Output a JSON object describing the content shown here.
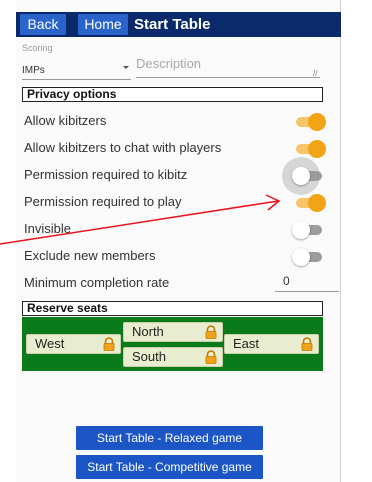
{
  "header": {
    "back_label": "Back",
    "home_label": "Home",
    "title": "Start Table"
  },
  "scoring": {
    "label": "Scoring",
    "value": "IMPs"
  },
  "description": {
    "placeholder": "Description"
  },
  "privacy": {
    "heading": "Privacy options",
    "options": [
      {
        "label": "Allow kibitzers",
        "on": true
      },
      {
        "label": "Allow kibitzers to chat with players",
        "on": true
      },
      {
        "label": "Permission required to kibitz",
        "on": false
      },
      {
        "label": "Permission required to play",
        "on": true
      },
      {
        "label": "Invisible",
        "on": false
      },
      {
        "label": "Exclude new members",
        "on": false
      }
    ],
    "min_completion_label": "Minimum completion rate",
    "min_completion_value": "0"
  },
  "reserve": {
    "heading": "Reserve seats",
    "seats": {
      "north": "North",
      "south": "South",
      "west": "West",
      "east": "East"
    }
  },
  "actions": {
    "relaxed_label": "Start Table - Relaxed game",
    "competitive_label": "Start Table - Competitive game"
  },
  "colors": {
    "topbar": "#0a2a6b",
    "top_button": "#2a63c9",
    "toggle_on": "#f3a316",
    "seat_area": "#0a7a1a",
    "action_button": "#1c56c6",
    "annotation_arrow": "#e8141c"
  },
  "icons": {
    "seat_lock": "lock-icon",
    "annotation": "arrow-annotation"
  }
}
